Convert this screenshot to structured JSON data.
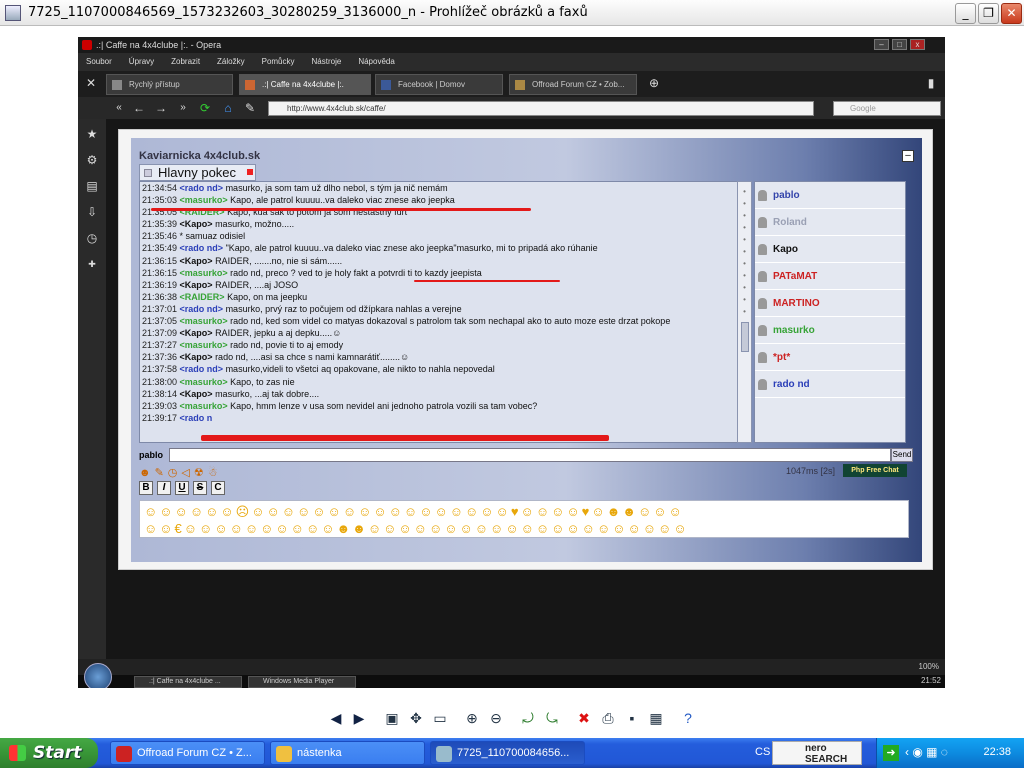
{
  "window": {
    "title": "7725_1107000846569_1573232603_30280259_3136000_n - Prohlížeč obrázků a faxů"
  },
  "opera": {
    "title": ".:| Caffe na 4x4clube |:. - Opera",
    "menu": [
      "Soubor",
      "Úpravy",
      "Zobrazit",
      "Záložky",
      "Pomůcky",
      "Nástroje",
      "Nápověda"
    ],
    "tabs": [
      "Rychlý přístup",
      ".:| Caffe na 4x4clube |:.",
      "Facebook | Domov",
      "Offroad Forum CZ • Zob..."
    ],
    "address": "http://www.4x4club.sk/caffe/",
    "search_placeholder": "Google",
    "status_zoom": "100%"
  },
  "chat": {
    "header": "Kaviarnicka 4x4club.sk",
    "room_tab": "Hlavny pokec",
    "messages": [
      {
        "time": "21:34:54",
        "nick": "<rado nd>",
        "color": "#2b3fb8",
        "text": "masurko, ja som tam už dlho nebol, s tým ja nič nemám"
      },
      {
        "time": "21:35:03",
        "nick": "<masurko>",
        "color": "#36a336",
        "text": "Kapo, ale patrol kuuuu..va daleko viac znese ako jeepka"
      },
      {
        "time": "21:35:05",
        "nick": "<RAIDER>",
        "color": "#36a336",
        "text": "Kapo, kua sak to potom ja som nestastny furt"
      },
      {
        "time": "21:35:39",
        "nick": "<Kapo>",
        "color": "#111",
        "text": "masurko, možno....."
      },
      {
        "time": "21:35:46",
        "nick": "",
        "color": "#111",
        "text": "* samuaz odisiel"
      },
      {
        "time": "21:35:49",
        "nick": "<rado nd>",
        "color": "#2b3fb8",
        "text": "\"Kapo, ale patrol kuuuu..va daleko viac znese ako jeepka\"masurko, mi to pripadá ako rúhanie"
      },
      {
        "time": "21:36:15",
        "nick": "<Kapo>",
        "color": "#111",
        "text": "RAIDER, .......no, nie si sám......"
      },
      {
        "time": "21:36:15",
        "nick": "<masurko>",
        "color": "#36a336",
        "text": "rado nd, preco ? ved to je holy fakt a potvrdi ti to kazdy jeepista"
      },
      {
        "time": "21:36:19",
        "nick": "<Kapo>",
        "color": "#111",
        "text": "RAIDER, ....aj JOSO"
      },
      {
        "time": "21:36:38",
        "nick": "<RAIDER>",
        "color": "#36a336",
        "text": "Kapo, on ma jeepku"
      },
      {
        "time": "21:37:01",
        "nick": "<rado nd>",
        "color": "#2b3fb8",
        "text": "masurko, prvý raz to počujem od džípkara nahlas a verejne"
      },
      {
        "time": "21:37:05",
        "nick": "<masurko>",
        "color": "#36a336",
        "text": "rado nd, ked som videl co matyas dokazoval s patrolom tak som nechapal ako to auto moze este drzat pokope",
        "wrap": true
      },
      {
        "time": "21:37:09",
        "nick": "<Kapo>",
        "color": "#111",
        "text": "RAIDER, jepku a aj depku.....☺"
      },
      {
        "time": "21:37:27",
        "nick": "<masurko>",
        "color": "#36a336",
        "text": "rado nd, povie ti to aj emody"
      },
      {
        "time": "21:37:36",
        "nick": "<Kapo>",
        "color": "#111",
        "text": "rado nd, ....asi sa chce s nami kamnarátiť........☺"
      },
      {
        "time": "21:37:58",
        "nick": "<rado nd>",
        "color": "#2b3fb8",
        "text": "masurko,videli to všetci aq opakovane, ale nikto to nahla nepovedal"
      },
      {
        "time": "21:38:00",
        "nick": "<masurko>",
        "color": "#36a336",
        "text": "Kapo, to zas nie"
      },
      {
        "time": "21:38:14",
        "nick": "<Kapo>",
        "color": "#111",
        "text": "masurko, ...aj tak dobre...."
      },
      {
        "time": "21:39:03",
        "nick": "<masurko>",
        "color": "#36a336",
        "text": "Kapo, hmm lenze v usa som nevidel ani jednoho patrola vozili sa tam vobec?"
      },
      {
        "time": "21:39:17",
        "nick": "<rado n",
        "color": "#2b3fb8",
        "text": ""
      }
    ],
    "users": [
      {
        "name": "pablo",
        "color": "#3344aa"
      },
      {
        "name": "Roland",
        "color": "#9aa0b4"
      },
      {
        "name": "Kapo",
        "color": "#111111"
      },
      {
        "name": "PATaMAT",
        "color": "#cc2222"
      },
      {
        "name": "MARTINO",
        "color": "#cc2222"
      },
      {
        "name": "masurko",
        "color": "#36a336"
      },
      {
        "name": "*pt*",
        "color": "#cc2222"
      },
      {
        "name": "rado nd",
        "color": "#2b3fb8"
      }
    ],
    "input_label": "pablo",
    "send_label": "Send",
    "ping": "1047ms",
    "ping_extra": "[2s]",
    "pfc_badge": "Php Free Chat",
    "format_buttons": [
      "B",
      "I",
      "U",
      "S",
      "C"
    ]
  },
  "vista_taskbar": {
    "items": [
      ".:| Caffe na 4x4clube ...",
      "Windows Media Player"
    ],
    "clock": "21:52"
  },
  "xp_taskbar": {
    "start": "Start",
    "items": [
      "Offroad Forum CZ • Z...",
      "nástenka",
      "7725_110700084656..."
    ],
    "lang": "CS",
    "nero": "nero SEARCH",
    "clock": "22:38"
  }
}
